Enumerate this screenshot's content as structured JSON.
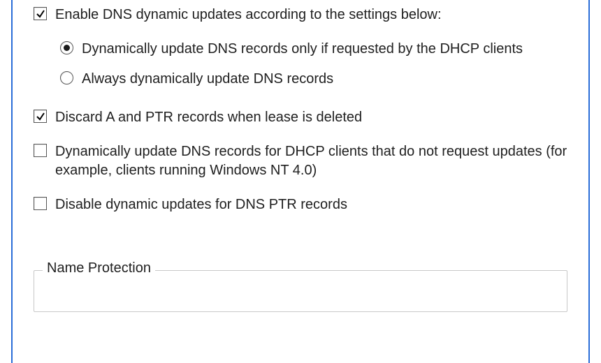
{
  "dns": {
    "enable_label": "Enable DNS dynamic updates according to the settings below:",
    "enable_checked": true,
    "update_mode": {
      "option_requested": "Dynamically update DNS records only if requested by the DHCP clients",
      "option_always": "Always dynamically update DNS records",
      "selected": "requested"
    },
    "discard_label": "Discard A and PTR records when lease is deleted",
    "discard_checked": true,
    "update_no_request_label": "Dynamically update DNS records for DHCP clients that do not request updates (for example, clients running Windows NT 4.0)",
    "update_no_request_checked": false,
    "disable_ptr_label": "Disable dynamic updates for DNS PTR records",
    "disable_ptr_checked": false
  },
  "groupbox": {
    "name_protection_legend": "Name Protection"
  }
}
